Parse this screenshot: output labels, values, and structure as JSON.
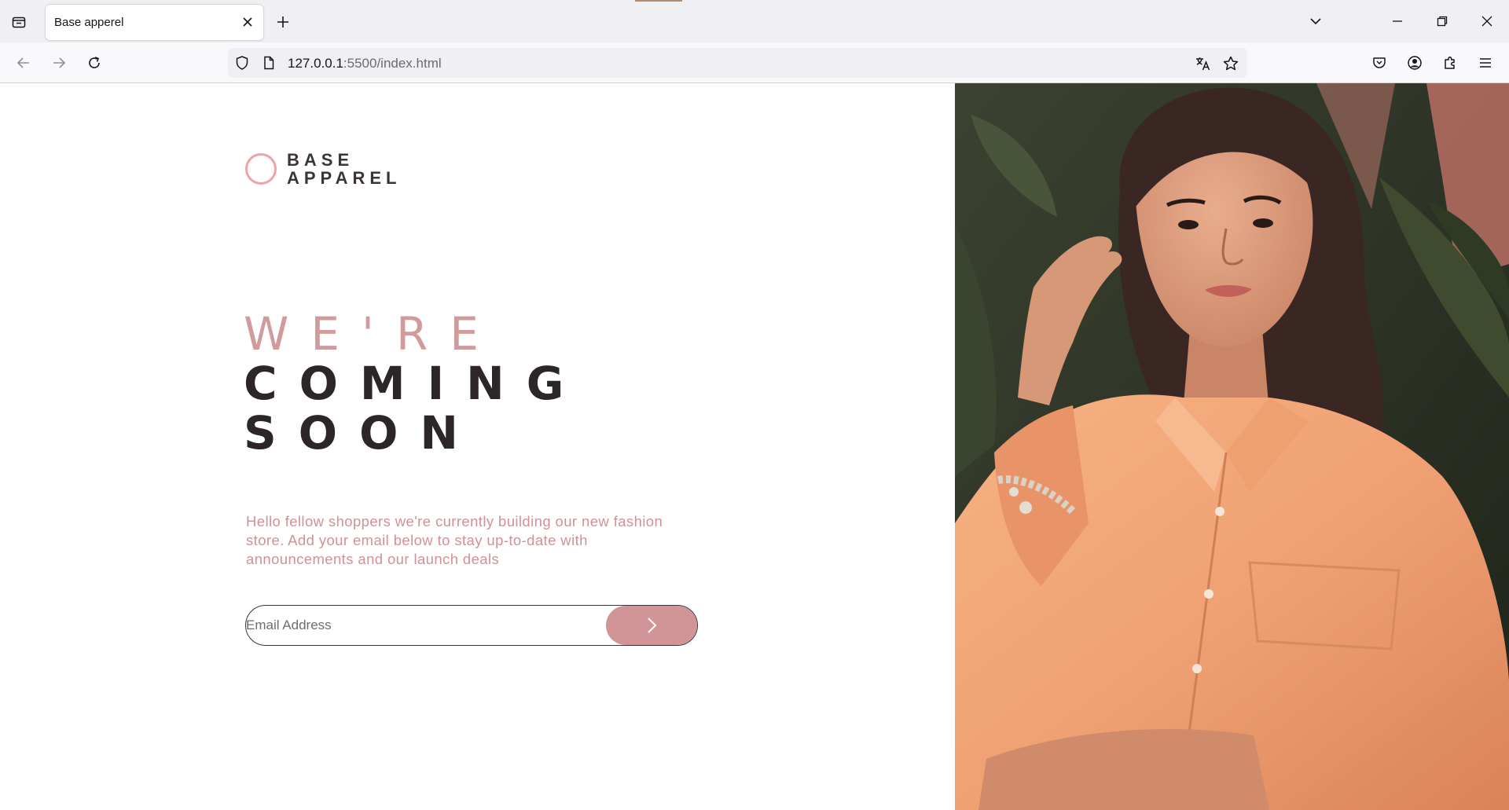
{
  "browser": {
    "tab_title": "Base apperel",
    "url_host": "127.0.0.1",
    "url_rest": ":5500/index.html"
  },
  "icons": {
    "tab_list": "tab-list-icon",
    "close_tab": "close-icon",
    "new_tab": "plus-icon",
    "list_all_tabs": "chevron-down-icon",
    "minimize": "minimize-icon",
    "restore": "restore-icon",
    "close_window": "close-icon",
    "back": "arrow-left-icon",
    "forward": "arrow-right-icon",
    "reload": "reload-icon",
    "tracking": "shield-icon",
    "page_info": "page-icon",
    "translate": "translate-icon",
    "bookmark": "star-icon",
    "pocket": "pocket-icon",
    "account": "account-icon",
    "extensions": "puzzle-icon",
    "menu": "hamburger-icon",
    "submit": "chevron-right-icon"
  },
  "page": {
    "logo_line1": "BASE",
    "logo_line2": "APPAREL",
    "headline_light": "WE'RE",
    "headline_dark_1": "COMING",
    "headline_dark_2": "SOON",
    "intro": "Hello fellow shoppers we're currently building our new fashion store. Add your email below to stay up-to-date with announcements and our launch deals",
    "email_placeholder": "Email Address",
    "email_value": ""
  },
  "colors": {
    "accent": "#d19597",
    "logo_ring": "#efa3a6",
    "dark_text": "#2c2627",
    "shirt": "#f2a579"
  }
}
